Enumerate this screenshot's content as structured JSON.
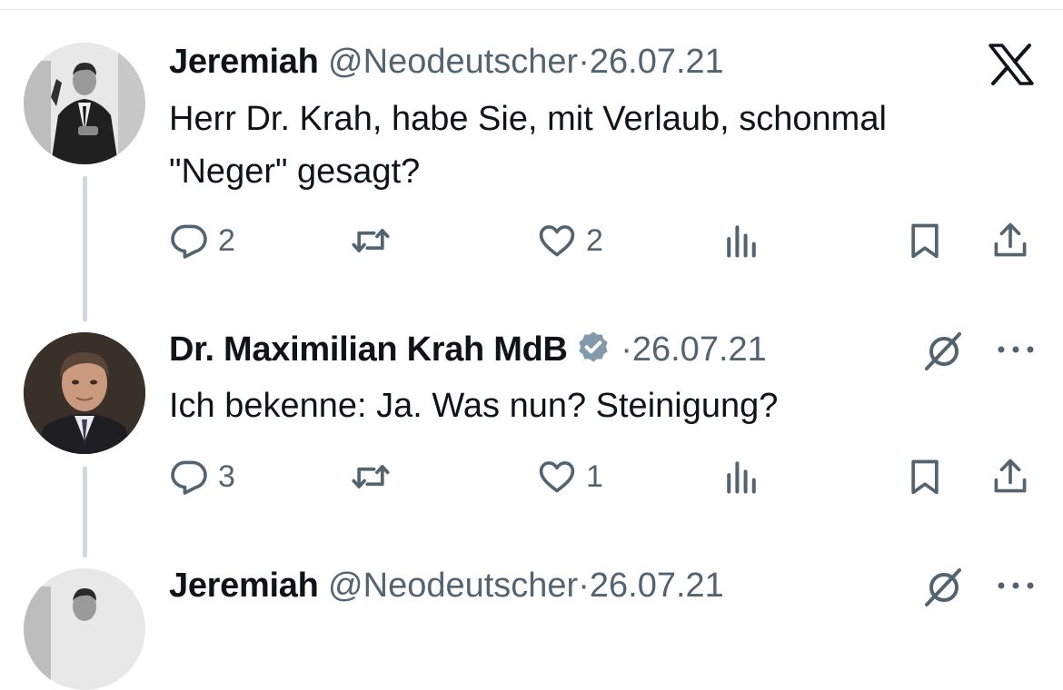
{
  "posts": [
    {
      "author": "Jeremiah",
      "handle": "@Neodeutscher",
      "separator": "·",
      "date": "26.07.21",
      "text_lines": [
        "Herr Dr. Krah, habe Sie, mit Verlaub, schonmal",
        "\"Neger\" gesagt?"
      ],
      "replies": "2",
      "retweets": "",
      "likes": "2",
      "corner_icon": "x-logo-icon",
      "avatar": "bw-photo-man-in-suit"
    },
    {
      "author": "Dr. Maximilian Krah MdB",
      "verified": true,
      "separator": "·",
      "date": "26.07.21",
      "text_lines": [
        "Ich bekenne: Ja. Was nun? Steinigung?"
      ],
      "replies": "3",
      "retweets": "",
      "likes": "1",
      "corner_icons": [
        "grok-icon",
        "more-icon"
      ],
      "avatar": "photo-man-portrait"
    },
    {
      "author": "Jeremiah",
      "handle": "@Neodeutscher",
      "separator": "·",
      "date": "26.07.21",
      "corner_icons": [
        "grok-icon",
        "more-icon"
      ],
      "avatar": "bw-photo-man-in-suit"
    }
  ],
  "colors": {
    "text": "#0f1419",
    "secondary": "#536471",
    "thread_line": "#cfd9de",
    "verified_badge": "#829aab"
  }
}
